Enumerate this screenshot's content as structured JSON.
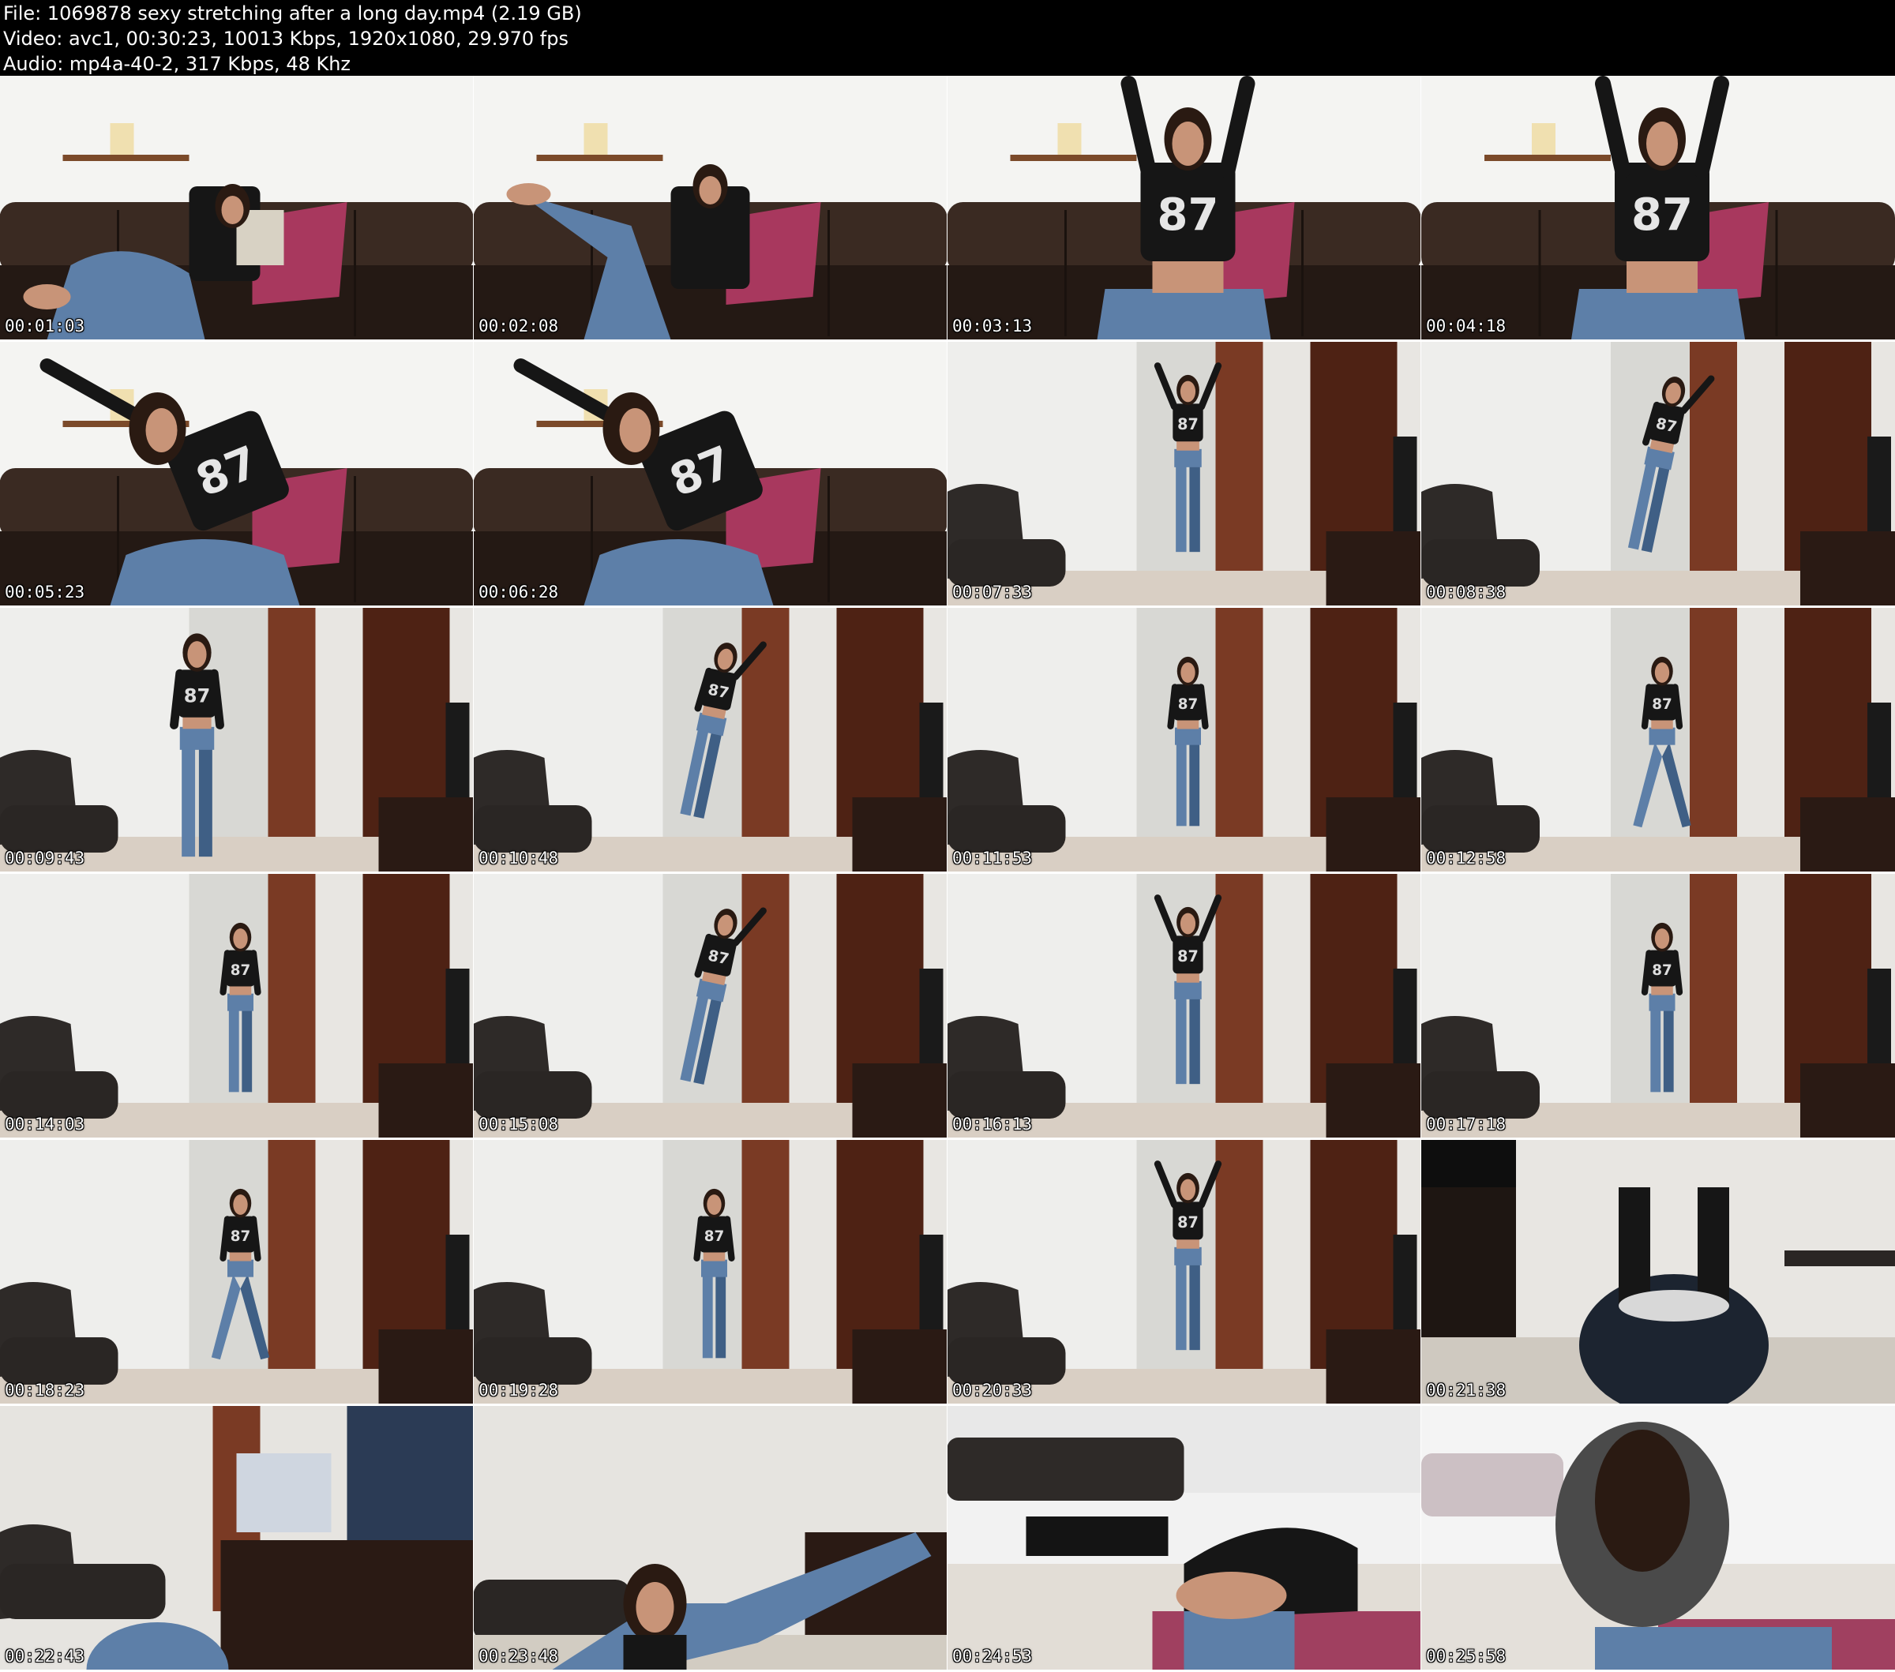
{
  "header": {
    "file_line": "File: 1069878 sexy stretching after a long day.mp4 (2.19 GB)",
    "video_line": "Video: avc1, 00:30:23, 10013 Kbps, 1920x1080, 29.970 fps",
    "audio_line": "Audio: mp4a-40-2, 317 Kbps, 48 Khz"
  },
  "thumbnails": [
    {
      "timestamp": "00:01:03",
      "scene": "sofa-reading"
    },
    {
      "timestamp": "00:02:08",
      "scene": "sofa-leg-up"
    },
    {
      "timestamp": "00:03:13",
      "scene": "sofa-arms-up"
    },
    {
      "timestamp": "00:04:18",
      "scene": "sofa-arms-up"
    },
    {
      "timestamp": "00:05:23",
      "scene": "sofa-side-stretch"
    },
    {
      "timestamp": "00:06:28",
      "scene": "sofa-side-stretch"
    },
    {
      "timestamp": "00:07:33",
      "scene": "wall-arms-up"
    },
    {
      "timestamp": "00:08:38",
      "scene": "wall-side-bend"
    },
    {
      "timestamp": "00:09:43",
      "scene": "wall-profile"
    },
    {
      "timestamp": "00:10:48",
      "scene": "wall-side-bend"
    },
    {
      "timestamp": "00:11:53",
      "scene": "wall-standing"
    },
    {
      "timestamp": "00:12:58",
      "scene": "wall-wide-stance"
    },
    {
      "timestamp": "00:14:03",
      "scene": "wall-standing"
    },
    {
      "timestamp": "00:15:08",
      "scene": "wall-side-bend"
    },
    {
      "timestamp": "00:16:13",
      "scene": "wall-arms-up"
    },
    {
      "timestamp": "00:17:18",
      "scene": "wall-standing"
    },
    {
      "timestamp": "00:18:23",
      "scene": "wall-wide-stance"
    },
    {
      "timestamp": "00:19:28",
      "scene": "wall-standing"
    },
    {
      "timestamp": "00:20:33",
      "scene": "wall-arms-up"
    },
    {
      "timestamp": "00:21:38",
      "scene": "floor-closeup"
    },
    {
      "timestamp": "00:22:43",
      "scene": "livingroom-floor"
    },
    {
      "timestamp": "00:23:48",
      "scene": "livingroom-plank"
    },
    {
      "timestamp": "00:24:53",
      "scene": "floor-wide"
    },
    {
      "timestamp": "00:25:58",
      "scene": "floor-wide-seated"
    }
  ],
  "colors": {
    "header_bg": "#000000",
    "header_text": "#ffffff",
    "timestamp_text": "#ffffff"
  }
}
